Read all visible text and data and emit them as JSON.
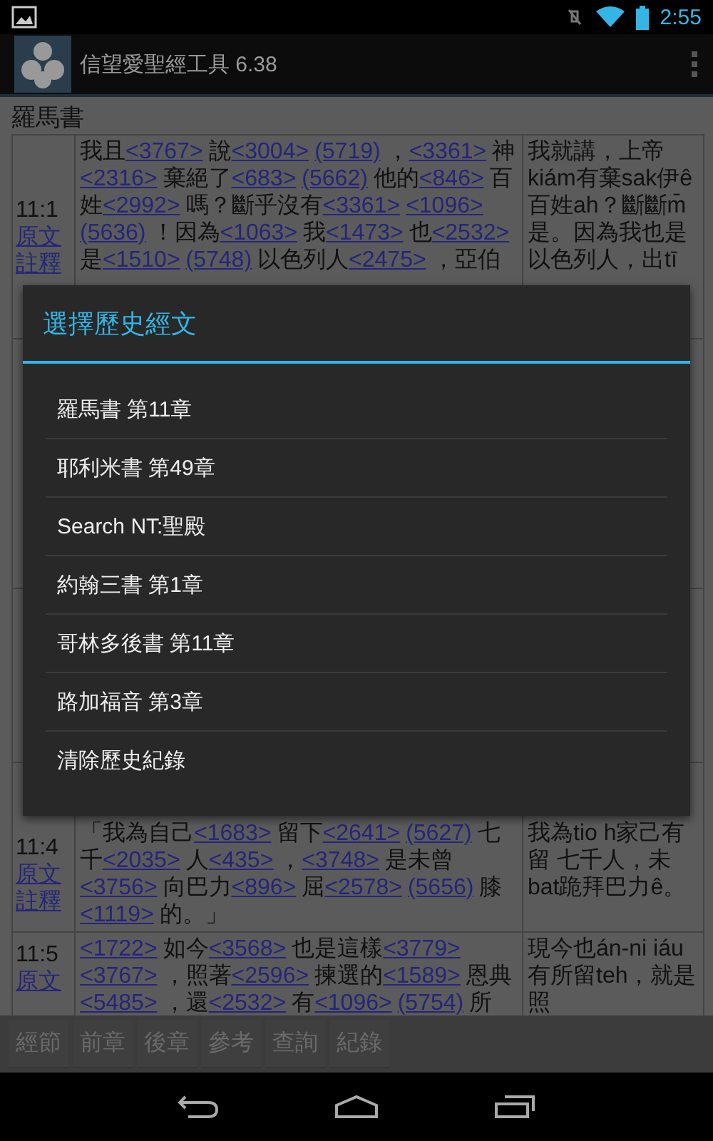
{
  "status_bar": {
    "time": "2:55"
  },
  "action_bar": {
    "title": "信望愛聖經工具 6.38"
  },
  "book_title": "羅馬書",
  "verses": [
    {
      "kind": "verse",
      "ref": "11:1",
      "links": [
        "原文",
        "註釋"
      ],
      "segments": [
        {
          "kind": "word",
          "text": "我且"
        },
        {
          "kind": "ref",
          "text": "<3767>"
        },
        {
          "kind": "word",
          "text": "說"
        },
        {
          "kind": "ref",
          "text": "<3004>"
        },
        {
          "kind": "ref",
          "text": "(5719)"
        },
        {
          "kind": "word",
          "text": "，"
        },
        {
          "kind": "ref",
          "text": "<3361>"
        },
        {
          "kind": "word",
          "text": "神"
        },
        {
          "kind": "ref",
          "text": "<2316>"
        },
        {
          "kind": "word",
          "text": "棄絕了"
        },
        {
          "kind": "ref",
          "text": "<683>"
        },
        {
          "kind": "ref",
          "text": "(5662)"
        },
        {
          "kind": "word",
          "text": "他的"
        },
        {
          "kind": "ref",
          "text": "<846>"
        },
        {
          "kind": "word",
          "text": "百姓"
        },
        {
          "kind": "ref",
          "text": "<2992>"
        },
        {
          "kind": "word",
          "text": "嗎？斷乎沒有"
        },
        {
          "kind": "ref",
          "text": "<3361>"
        },
        {
          "kind": "ref",
          "text": "<1096>"
        },
        {
          "kind": "ref",
          "text": "(5636)"
        },
        {
          "kind": "word",
          "text": "！因為"
        },
        {
          "kind": "ref",
          "text": "<1063>"
        },
        {
          "kind": "word",
          "text": "我"
        },
        {
          "kind": "ref",
          "text": "<1473>"
        },
        {
          "kind": "word",
          "text": "也"
        },
        {
          "kind": "ref",
          "text": "<2532>"
        },
        {
          "kind": "word",
          "text": "是"
        },
        {
          "kind": "ref",
          "text": "<1510>"
        },
        {
          "kind": "ref",
          "text": "(5748)"
        },
        {
          "kind": "word",
          "text": "以色列人"
        },
        {
          "kind": "ref",
          "text": "<2475>"
        },
        {
          "kind": "word",
          "text": "，亞伯"
        }
      ],
      "taiwanese": "我就講，上帝kiám有棄sak伊ê百姓ah？斷斷m̄是。因為我也是以色列人，出tī"
    },
    {
      "kind": "covered"
    },
    {
      "kind": "covered"
    },
    {
      "kind": "verse",
      "ref": "11:4",
      "links": [
        "原文",
        "註釋"
      ],
      "segments": [
        {
          "kind": "word",
          "text": "「我為自己"
        },
        {
          "kind": "ref",
          "text": "<1683>"
        },
        {
          "kind": "word",
          "text": "留下"
        },
        {
          "kind": "ref",
          "text": "<2641>"
        },
        {
          "kind": "ref",
          "text": "(5627)"
        },
        {
          "kind": "word",
          "text": "七千"
        },
        {
          "kind": "ref",
          "text": "<2035>"
        },
        {
          "kind": "word",
          "text": "人"
        },
        {
          "kind": "ref",
          "text": "<435>"
        },
        {
          "kind": "word",
          "text": "，"
        },
        {
          "kind": "ref",
          "text": "<3748>"
        },
        {
          "kind": "word",
          "text": "是未曾"
        },
        {
          "kind": "ref",
          "text": "<3756>"
        },
        {
          "kind": "word",
          "text": "向巴力"
        },
        {
          "kind": "ref",
          "text": "<896>"
        },
        {
          "kind": "word",
          "text": "屈"
        },
        {
          "kind": "ref",
          "text": "<2578>"
        },
        {
          "kind": "ref",
          "text": "(5656)"
        },
        {
          "kind": "word",
          "text": "膝"
        },
        {
          "kind": "ref",
          "text": "<1119>"
        },
        {
          "kind": "word",
          "text": "的。」"
        }
      ],
      "taiwanese": "我為tio h家己有留 七千人，未bat跪拜巴力ê。"
    },
    {
      "kind": "verse",
      "ref": "11:5",
      "links": [
        "原文"
      ],
      "segments": [
        {
          "kind": "ref",
          "text": "<1722>"
        },
        {
          "kind": "word",
          "text": "如今"
        },
        {
          "kind": "ref",
          "text": "<3568>"
        },
        {
          "kind": "word",
          "text": "也是這樣"
        },
        {
          "kind": "ref",
          "text": "<3779>"
        },
        {
          "kind": "ref",
          "text": "<3767>"
        },
        {
          "kind": "word",
          "text": "，照著"
        },
        {
          "kind": "ref",
          "text": "<2596>"
        },
        {
          "kind": "word",
          "text": "揀選的"
        },
        {
          "kind": "ref",
          "text": "<1589>"
        },
        {
          "kind": "word",
          "text": "恩典"
        },
        {
          "kind": "ref",
          "text": "<5485>"
        },
        {
          "kind": "word",
          "text": "，還"
        },
        {
          "kind": "ref",
          "text": "<2532>"
        },
        {
          "kind": "word",
          "text": "有"
        },
        {
          "kind": "ref",
          "text": "<1096>"
        },
        {
          "kind": "ref",
          "text": "(5754)"
        },
        {
          "kind": "word",
          "text": "所"
        }
      ],
      "taiwanese": "現今也án-ni iáu有所留teh，就是照"
    }
  ],
  "dialog": {
    "title": "選擇歷史經文",
    "items": [
      "羅馬書 第11章",
      "耶利米書 第49章",
      "Search NT:聖殿",
      "約翰三書 第1章",
      "哥林多後書 第11章",
      "路加福音 第3章",
      "清除歷史紀錄"
    ]
  },
  "toolbar": {
    "buttons": [
      "經節",
      "前章",
      "後章",
      "參考",
      "查詢",
      "紀錄"
    ]
  }
}
